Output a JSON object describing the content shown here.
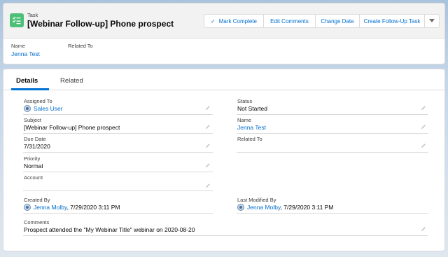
{
  "header": {
    "object_label": "Task",
    "record_title": "[Webinar Follow-up] Phone prospect",
    "icon": "task-list-icon",
    "icon_color": "#4bc076",
    "buttons": {
      "mark_complete": "Mark Complete",
      "edit_comments": "Edit Comments",
      "change_date": "Change Date",
      "create_follow_up": "Create Follow-Up Task"
    },
    "highlights": {
      "name_label": "Name",
      "name_value": "Jenna Test",
      "related_label": "Related To",
      "related_value": ""
    }
  },
  "tabs": {
    "details": "Details",
    "related": "Related"
  },
  "details": {
    "assigned_to": {
      "label": "Assigned To",
      "value": "Sales User"
    },
    "status": {
      "label": "Status",
      "value": "Not Started"
    },
    "subject": {
      "label": "Subject",
      "value": "[Webinar Follow-up] Phone prospect"
    },
    "name": {
      "label": "Name",
      "value": "Jenna Test"
    },
    "due_date": {
      "label": "Due Date",
      "value": "7/31/2020"
    },
    "related_to": {
      "label": "Related To",
      "value": ""
    },
    "priority": {
      "label": "Priority",
      "value": "Normal"
    },
    "account": {
      "label": "Account",
      "value": ""
    },
    "created_by": {
      "label": "Created By",
      "user": "Jenna Molby",
      "date": ", 7/29/2020 3:11 PM"
    },
    "last_modified_by": {
      "label": "Last Modified By",
      "user": "Jenna Molby",
      "date": ", 7/29/2020 3:11 PM"
    },
    "comments": {
      "label": "Comments",
      "value": "Prospect attended the \"My Webinar Title\" webinar on 2020-08-20"
    }
  },
  "colors": {
    "link": "#006dcc",
    "brand": "#0070d2",
    "border": "#dddbda"
  }
}
